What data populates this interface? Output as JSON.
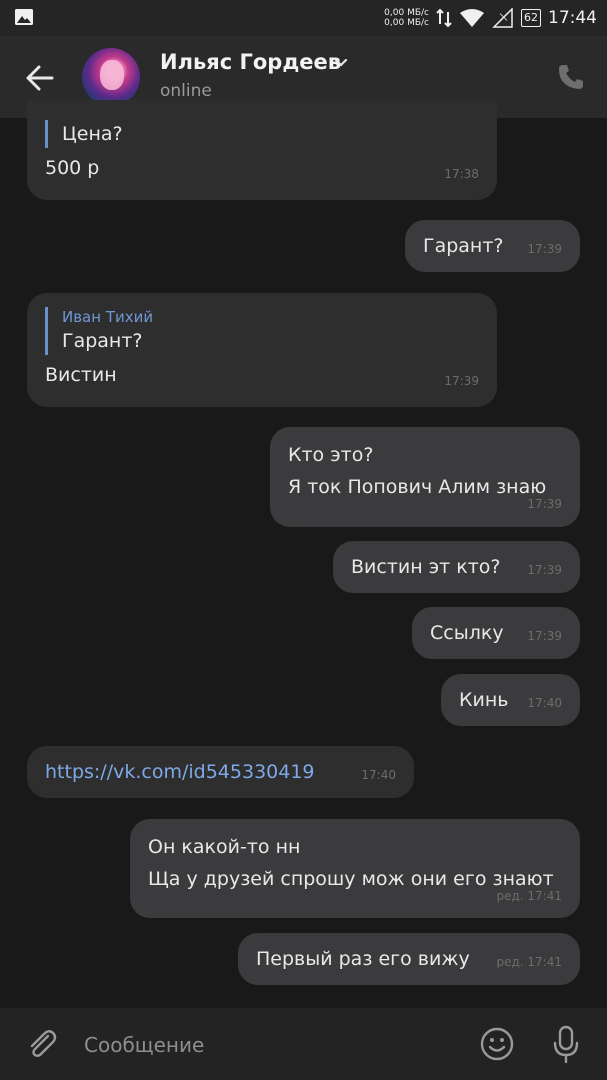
{
  "status_bar": {
    "speed_up": "0,00 МБ/с",
    "speed_down": "0,00 МБ/с",
    "battery": "62",
    "time": "17:44"
  },
  "header": {
    "contact_name": "Ильяс Гордеев",
    "contact_status": "online"
  },
  "messages": [
    {
      "direction": "in",
      "reply_text": "Цена?",
      "text": "500 р",
      "time": "17:38"
    },
    {
      "direction": "out",
      "text": "Гарант?",
      "time": "17:39"
    },
    {
      "direction": "in",
      "reply_author": "Иван Тихий",
      "reply_text": "Гарант?",
      "text": "Вистин",
      "time": "17:39"
    },
    {
      "direction": "out",
      "lines": [
        "Кто это?",
        "Я ток Попович Алим знаю"
      ],
      "time": "17:39"
    },
    {
      "direction": "out",
      "text": "Вистин эт кто?",
      "time": "17:39"
    },
    {
      "direction": "out",
      "text": "Ссылку",
      "time": "17:39"
    },
    {
      "direction": "out",
      "text": "Кинь",
      "time": "17:40"
    },
    {
      "direction": "in",
      "link": "https://vk.com/id545330419",
      "time": "17:40"
    },
    {
      "direction": "out",
      "lines": [
        "Он какой-то нн",
        "Ща у друзей спрошу мож они его знают"
      ],
      "time": "ред. 17:41"
    },
    {
      "direction": "out",
      "text": "Первый раз его вижу",
      "time": "ред. 17:41"
    }
  ],
  "composer": {
    "placeholder": "Сообщение"
  },
  "colors": {
    "background": "#19191a",
    "bubble_in": "#2e2e2f",
    "bubble_out": "#3b3b3d",
    "reply_accent": "#6b8fc7",
    "link": "#7fa9e6"
  },
  "icons": [
    "gallery-icon",
    "data-arrows-icon",
    "wifi-icon",
    "signal-icon",
    "battery-icon",
    "back-arrow-icon",
    "chevron-down-icon",
    "phone-icon",
    "paperclip-icon",
    "emoji-icon",
    "microphone-icon"
  ]
}
